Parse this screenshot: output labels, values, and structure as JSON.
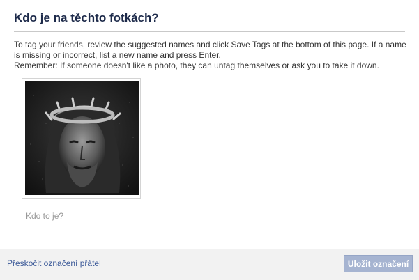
{
  "dialog": {
    "title": "Kdo je na těchto fotkách?",
    "instructions": [
      "To tag your friends, review the suggested names and click Save Tags at the bottom of this page. If a name is missing or incorrect, list a new name and press Enter.",
      "Remember: If someone doesn't like a photo, they can untag themselves or ask you to take it down."
    ]
  },
  "photo": {
    "icon": "photo-thumbnail"
  },
  "tag_input": {
    "value": "",
    "placeholder": "Kdo to je?"
  },
  "footer": {
    "skip_label": "Přeskočit označení přátel",
    "save_label": "Uložit označení"
  },
  "colors": {
    "title": "#1d2a4a",
    "link": "#3b5998",
    "save_button_bg": "#a6b4d1",
    "footer_bg": "#f2f2f2"
  }
}
